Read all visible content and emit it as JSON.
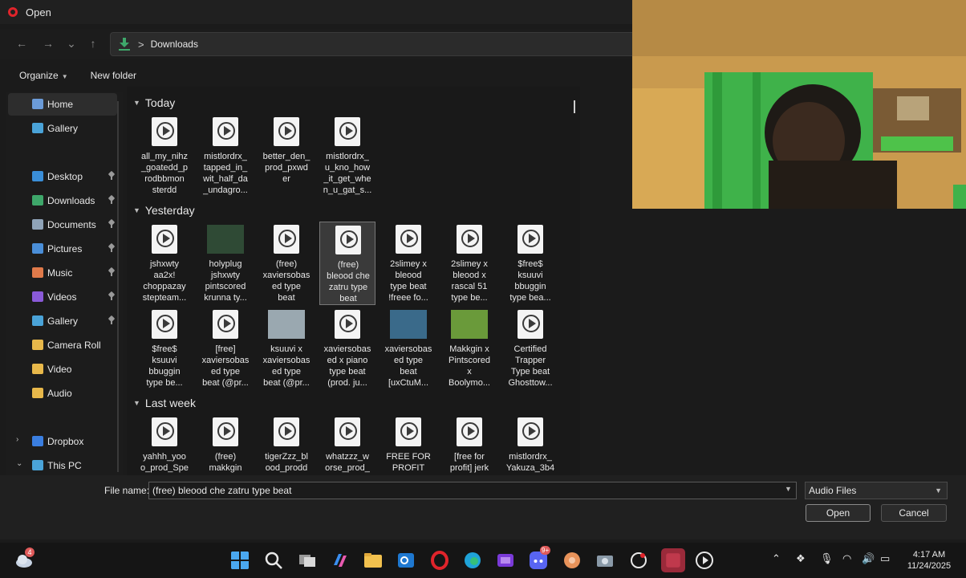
{
  "window": {
    "title": "Open"
  },
  "address": {
    "crumb": "Downloads",
    "separator": ">"
  },
  "nav": {
    "back": "←",
    "forward": "→",
    "history": "⌄",
    "up": "↑"
  },
  "toolbar": {
    "organize": "Organize",
    "new_folder": "New folder"
  },
  "sidebar": {
    "items": [
      {
        "label": "Home",
        "icon": "home-icon",
        "color": "#6b9bd8",
        "pinned": false,
        "active": true
      },
      {
        "label": "Gallery",
        "icon": "gallery-icon",
        "color": "#4aa3d8",
        "pinned": false
      },
      {
        "label": "Desktop",
        "icon": "desktop-icon",
        "color": "#3a8ed8",
        "pinned": true
      },
      {
        "label": "Downloads",
        "icon": "downloads-icon",
        "color": "#3ea76a",
        "pinned": true
      },
      {
        "label": "Documents",
        "icon": "documents-icon",
        "color": "#8fa3b8",
        "pinned": true
      },
      {
        "label": "Pictures",
        "icon": "pictures-icon",
        "color": "#4a8ed8",
        "pinned": true
      },
      {
        "label": "Music",
        "icon": "music-icon",
        "color": "#e07a4a",
        "pinned": true
      },
      {
        "label": "Videos",
        "icon": "videos-icon",
        "color": "#8a5ad8",
        "pinned": true
      },
      {
        "label": "Gallery",
        "icon": "gallery-icon",
        "color": "#4aa3d8",
        "pinned": true
      },
      {
        "label": "Camera Roll",
        "icon": "folder-icon",
        "color": "#e8b84a",
        "pinned": false
      },
      {
        "label": "Video",
        "icon": "folder-icon",
        "color": "#e8b84a",
        "pinned": false
      },
      {
        "label": "Audio",
        "icon": "folder-icon",
        "color": "#e8b84a",
        "pinned": false
      },
      {
        "label": "Dropbox",
        "icon": "dropbox-icon",
        "color": "#3a7ee0",
        "pinned": false
      },
      {
        "label": "This PC",
        "icon": "pc-icon",
        "color": "#4aa3d8",
        "pinned": false
      }
    ]
  },
  "groups": [
    {
      "title": "Today",
      "files": [
        {
          "name": "all_my_nihz\n_goatedd_p\nrodbbmon\nsterdd"
        },
        {
          "name": "mistlordrx_\ntapped_in_\nwit_half_da\n_undagro..."
        },
        {
          "name": "better_den_\nprod_pxwd\ner"
        },
        {
          "name": "mistlordrx_\nu_kno_how\n_it_get_whe\nn_u_gat_s..."
        }
      ]
    },
    {
      "title": "Yesterday",
      "files": [
        {
          "name": "jshxwty\naa2x!\nchoppazay\nstepteam..."
        },
        {
          "name": "holyplug\njshxwty\npintscored\nkrunna ty...",
          "thumb": "image"
        },
        {
          "name": "(free)\nxaviersobas\ned type\nbeat"
        },
        {
          "name": "(free)\nbleood che\nzatru type\nbeat",
          "selected": true
        },
        {
          "name": "2slimey x\nbleood\ntype beat\n!freee fo..."
        },
        {
          "name": "2slimey x\nbleood x\nrascal 51\ntype be..."
        },
        {
          "name": "$free$\nksuuvi\nbbuggin\ntype bea..."
        },
        {
          "name": "$free$\nksuuvi\nbbuggin\ntype be..."
        },
        {
          "name": "[free]\nxaviersobas\ned type\nbeat (@pr..."
        },
        {
          "name": "ksuuvi x\nxaviersobas\ned type\nbeat (@pr...",
          "thumb": "image"
        },
        {
          "name": "xaviersobas\ned x piano\ntype beat\n(prod. ju..."
        },
        {
          "name": "xaviersobas\ned type\nbeat\n[uxCtuM...",
          "thumb": "image"
        },
        {
          "name": "Makkgin x\nPintscored\nx\nBoolymo...",
          "thumb": "image"
        },
        {
          "name": "Certified\nTrapper\nType beat\nGhosttow..."
        }
      ]
    },
    {
      "title": "Last week",
      "files": [
        {
          "name": "yahhh_yoo\no_prod_Spe"
        },
        {
          "name": "(free)\nmakkgin"
        },
        {
          "name": "tigerZzz_bl\nood_prodd"
        },
        {
          "name": "whatzzz_w\norse_prod_"
        },
        {
          "name": "FREE FOR\nPROFIT"
        },
        {
          "name": "[free for\nprofit] jerk"
        },
        {
          "name": "mistlordrx_\nYakuza_3b4"
        }
      ]
    }
  ],
  "bottom": {
    "file_name_label": "File name:",
    "file_name_value": "(free) bleood che zatru type beat",
    "file_type": "Audio Files",
    "open_label": "Open",
    "cancel_label": "Cancel"
  },
  "taskbar": {
    "time": "4:17 AM",
    "date": "11/24/2025",
    "badge": "4",
    "discord_badge": "9+",
    "icons": [
      "start-icon",
      "search-icon",
      "task-view-icon",
      "copilot-icon",
      "file-explorer-icon",
      "outlook-icon",
      "opera-icon",
      "edge-icon",
      "clipchamp-icon",
      "discord-icon",
      "game-icon",
      "camera-icon",
      "capture-icon",
      "app-icon",
      "media-player-icon"
    ]
  },
  "colors": {
    "accent": "#3ea76a",
    "opera": "#e0242b",
    "selection": "#3a3a3a"
  }
}
